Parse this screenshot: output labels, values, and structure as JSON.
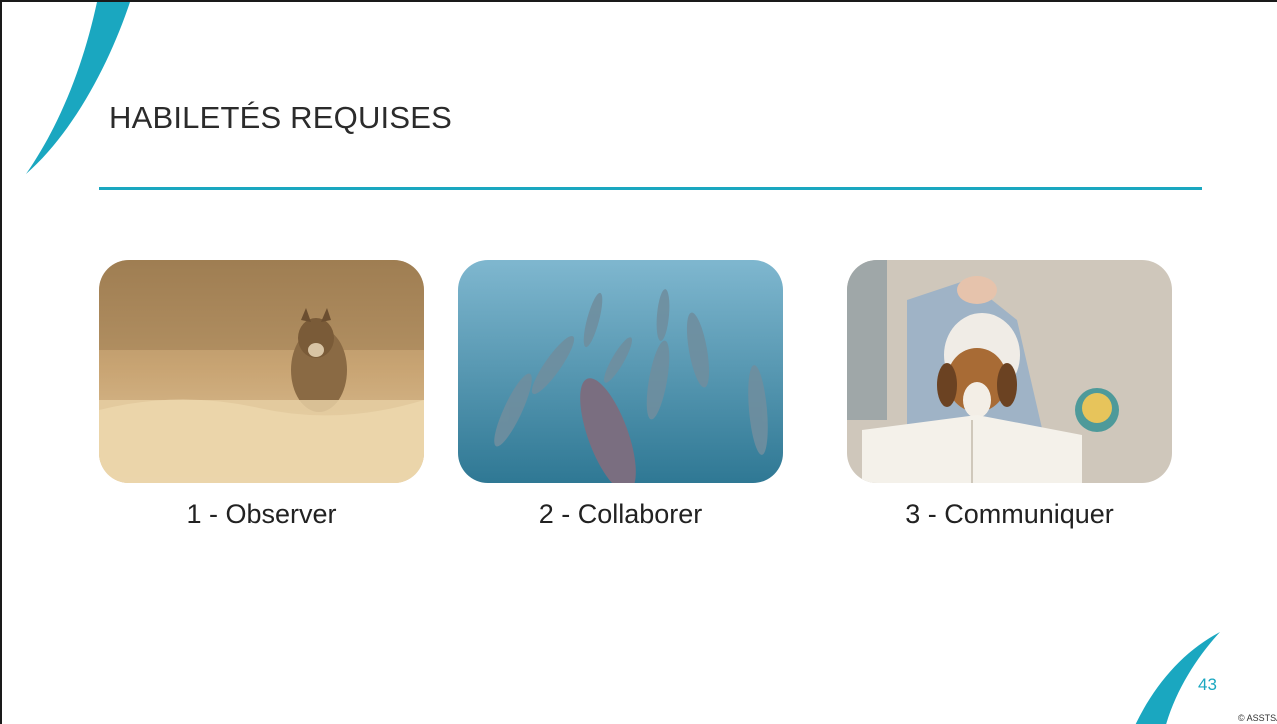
{
  "slide": {
    "title": "HABILETÉS REQUISES",
    "accent_color": "#1aa7c0",
    "page_number": "43",
    "copyright": "© ASSTSA"
  },
  "cards": [
    {
      "caption": "1 - Observer",
      "image": "cougar-in-grass-photo"
    },
    {
      "caption": "2 - Collaborer",
      "image": "dolphins-underwater-photo"
    },
    {
      "caption": "3 - Communiquer",
      "image": "dog-on-lap-with-book-photo"
    }
  ]
}
